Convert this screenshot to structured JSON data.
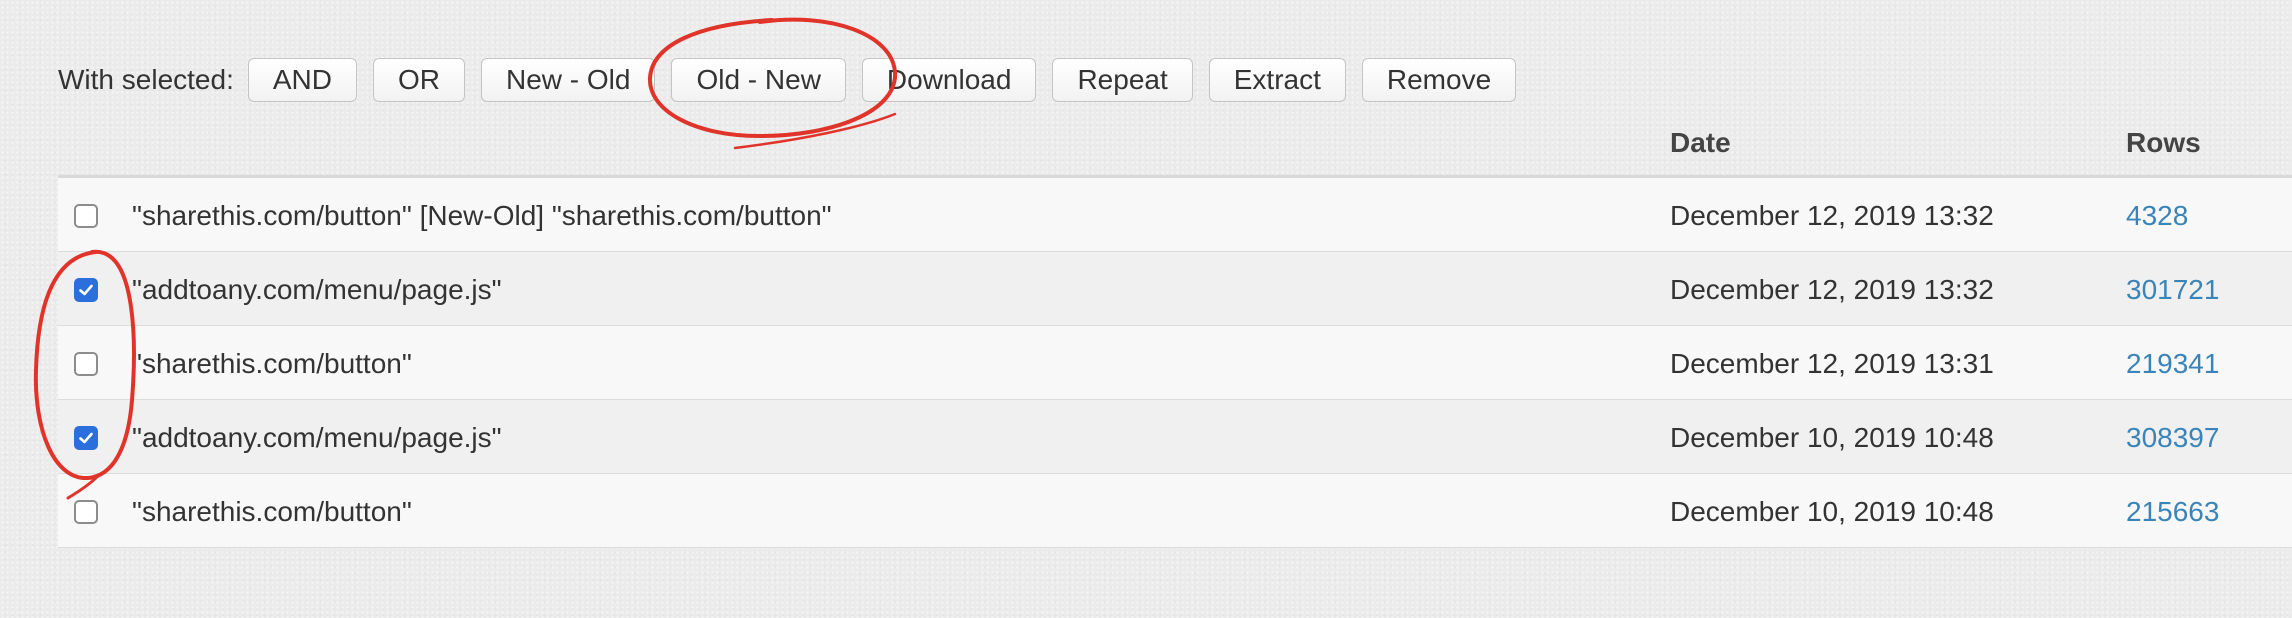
{
  "toolbar": {
    "label": "With selected:",
    "buttons": [
      "AND",
      "OR",
      "New - Old",
      "Old - New",
      "Download",
      "Repeat",
      "Extract",
      "Remove"
    ]
  },
  "table": {
    "headers": {
      "query": "",
      "date": "Date",
      "rows": "Rows"
    },
    "rows": [
      {
        "checked": false,
        "query": "\"sharethis.com/button\" [New-Old] \"sharethis.com/button\"",
        "date": "December 12, 2019 13:32",
        "rows": "4328"
      },
      {
        "checked": true,
        "query": "\"addtoany.com/menu/page.js\"",
        "date": "December 12, 2019 13:32",
        "rows": "301721"
      },
      {
        "checked": false,
        "query": "\"sharethis.com/button\"",
        "date": "December 12, 2019 13:31",
        "rows": "219341"
      },
      {
        "checked": true,
        "query": "\"addtoany.com/menu/page.js\"",
        "date": "December 10, 2019 10:48",
        "rows": "308397"
      },
      {
        "checked": false,
        "query": "\"sharethis.com/button\"",
        "date": "December 10, 2019 10:48",
        "rows": "215663"
      }
    ]
  },
  "colors": {
    "link": "#3a84b8",
    "checkbox_checked": "#2a6fdb",
    "annotation": "#e0342a"
  },
  "annotations": [
    {
      "type": "circle",
      "target": "Old - New button"
    },
    {
      "type": "circle",
      "target": "row checkboxes"
    }
  ]
}
